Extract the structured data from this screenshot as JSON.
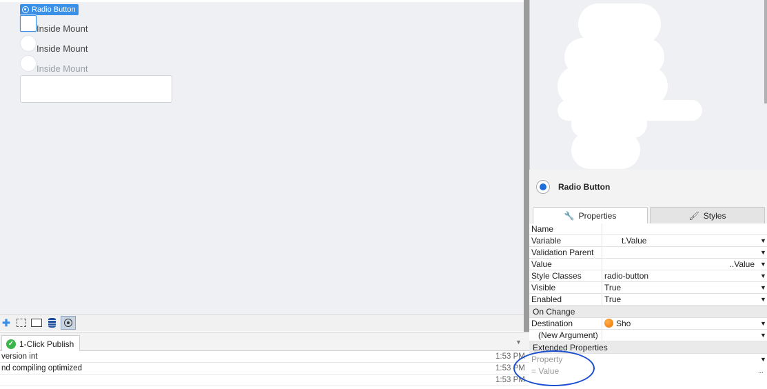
{
  "canvas": {
    "widget_tag": "Radio Button",
    "radios": [
      {
        "label": "Inside Mount",
        "state": "selected"
      },
      {
        "label": "Inside Mount",
        "state": "normal"
      },
      {
        "label": "Inside Mount",
        "state": "faded"
      }
    ]
  },
  "toolbar": {
    "icons": [
      "add-icon",
      "container-icon",
      "rectangle-icon",
      "database-icon",
      "radio-icon"
    ]
  },
  "output": {
    "tab_label": "1-Click Publish",
    "rows": [
      {
        "text": " version int",
        "time": "1:53 PM"
      },
      {
        "text": "nd compiling optimized",
        "time": "1:53 PM"
      },
      {
        "text": "",
        "time": "1:53 PM"
      }
    ]
  },
  "properties": {
    "widget_title": "Radio Button",
    "tabs": [
      "Properties",
      "Styles"
    ],
    "rows": [
      {
        "name": "Name",
        "value": "",
        "dropdown": false
      },
      {
        "name": "Variable",
        "value": "t.Value",
        "dropdown": true
      },
      {
        "name": "Validation Parent",
        "value": "",
        "dropdown": true
      },
      {
        "name": "Value",
        "value": "..Value",
        "dropdown": true
      },
      {
        "name": "Style Classes",
        "value": "radio-button",
        "dropdown": true
      },
      {
        "name": "Visible",
        "value": "True",
        "dropdown": true
      },
      {
        "name": "Enabled",
        "value": "True",
        "dropdown": true
      }
    ],
    "on_change_section": "On Change",
    "destination_label": "Destination",
    "destination_value": "Sho",
    "new_argument_label": "(New Argument)",
    "extended_section": "Extended Properties",
    "ext_property_placeholder": "Property",
    "ext_value_placeholder": "=  Value",
    "ext_ellipsis": "..."
  },
  "colors": {
    "accent": "#3a8fe6",
    "annotation": "#1b4fd0",
    "destination_dot": "#f07000"
  }
}
